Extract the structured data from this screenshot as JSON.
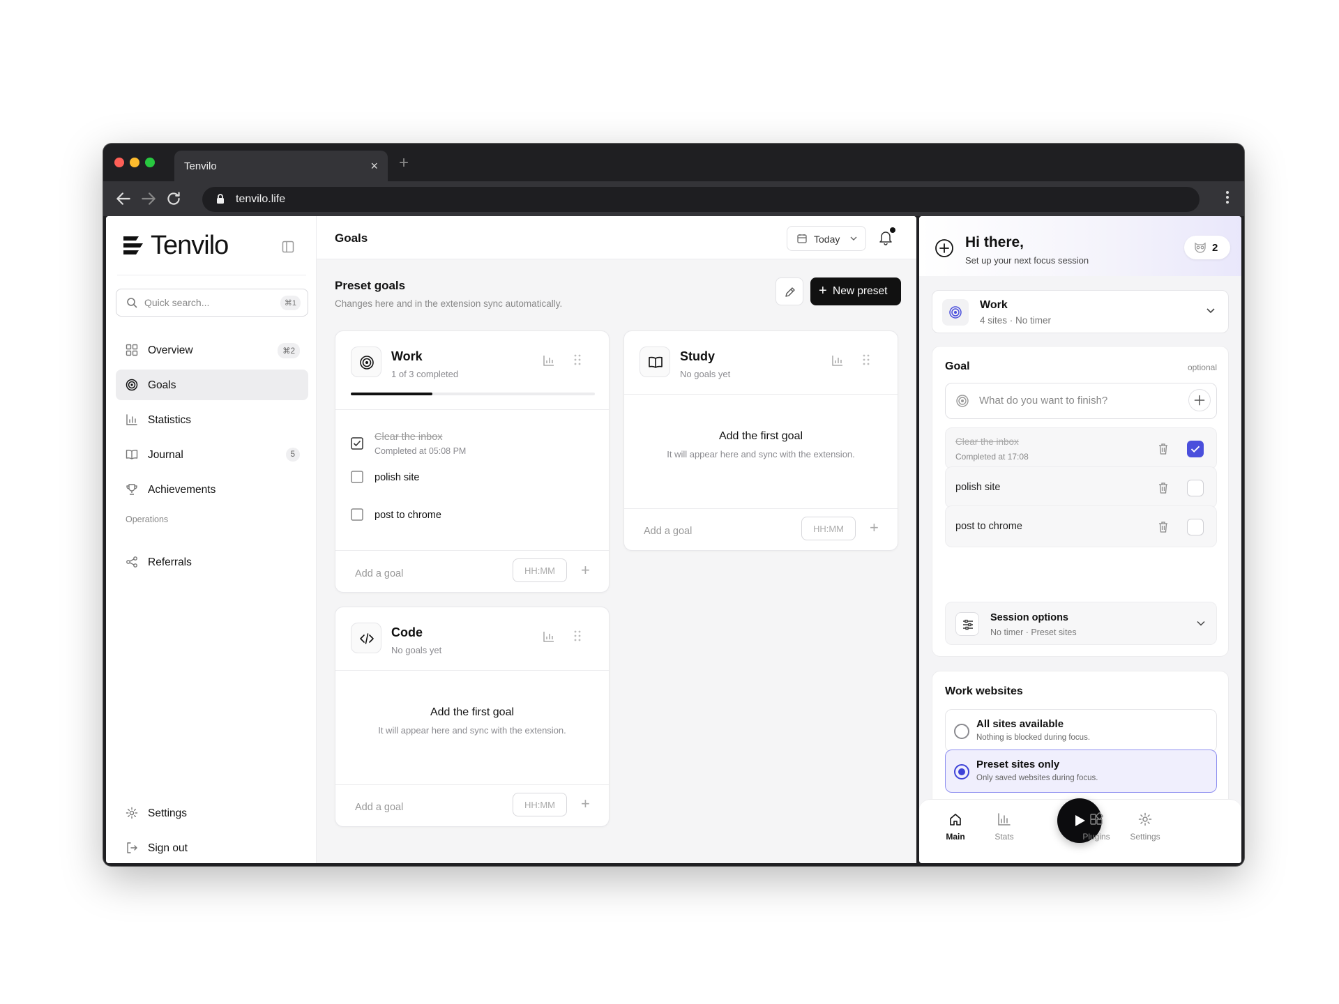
{
  "browser": {
    "tab_title": "Tenvilo",
    "url": "tenvilo.life"
  },
  "sidebar": {
    "brand": "Tenvilo",
    "search_placeholder": "Quick search...",
    "search_shortcut": "⌘1",
    "nav": [
      {
        "label": "Overview",
        "icon": "grid-icon",
        "badge": "⌘2"
      },
      {
        "label": "Goals",
        "icon": "target-icon",
        "active": true
      },
      {
        "label": "Statistics",
        "icon": "bar-chart-icon"
      },
      {
        "label": "Journal",
        "icon": "book-icon",
        "badge": "5"
      },
      {
        "label": "Achievements",
        "icon": "trophy-icon"
      }
    ],
    "section_label": "Operations",
    "referrals": "Referrals",
    "settings": "Settings",
    "sign_out": "Sign out"
  },
  "header": {
    "title": "Goals",
    "date_filter": "Today"
  },
  "presets": {
    "title": "Preset goals",
    "subtitle": "Changes here and in the extension sync automatically.",
    "new_button": "New preset",
    "cards": [
      {
        "name": "Work",
        "status": "1 of 3 completed",
        "progress": 0.333,
        "goals": [
          {
            "text": "Clear the inbox",
            "done": true,
            "completed_at": "Completed at 05:08 PM"
          },
          {
            "text": "polish site",
            "done": false
          },
          {
            "text": "post to chrome",
            "done": false
          }
        ],
        "add_placeholder": "Add a goal",
        "time_placeholder": "HH:MM"
      },
      {
        "name": "Study",
        "status": "No goals yet",
        "empty_title": "Add the first goal",
        "empty_sub": "It will appear here and sync with the extension.",
        "add_placeholder": "Add a goal",
        "time_placeholder": "HH:MM"
      },
      {
        "name": "Code",
        "status": "No goals yet",
        "empty_title": "Add the first goal",
        "empty_sub": "It will appear here and sync with the extension.",
        "add_placeholder": "Add a goal",
        "time_placeholder": "HH:MM"
      }
    ]
  },
  "extension": {
    "greeting": "Hi there,",
    "greeting_sub": "Set up your next focus session",
    "streak_count": "2",
    "preset": {
      "name": "Work",
      "meta": "4 sites · No timer"
    },
    "goal_section": {
      "title": "Goal",
      "optional": "optional",
      "input_placeholder": "What do you want to finish?",
      "goals": [
        {
          "text": "Clear the inbox",
          "done": true,
          "completed_at": "Completed at 17:08"
        },
        {
          "text": "polish site",
          "done": false
        },
        {
          "text": "post to chrome",
          "done": false
        }
      ]
    },
    "session": {
      "title": "Session options",
      "meta": "No timer · Preset sites"
    },
    "websites": {
      "title": "Work websites",
      "options": [
        {
          "title": "All sites available",
          "sub": "Nothing is blocked during focus.",
          "selected": false
        },
        {
          "title": "Preset sites only",
          "sub": "Only saved websites during focus.",
          "selected": true
        }
      ]
    },
    "bottom_nav": [
      {
        "label": "Main",
        "icon": "home-icon",
        "active": true
      },
      {
        "label": "Stats",
        "icon": "bar-chart-icon"
      },
      {
        "label": "Plugins",
        "icon": "plugins-icon"
      },
      {
        "label": "Settings",
        "icon": "gear-icon"
      }
    ]
  },
  "colors": {
    "accent": "#4a4fdc",
    "primary_button": "#111111",
    "progress_fill": "#111111"
  }
}
